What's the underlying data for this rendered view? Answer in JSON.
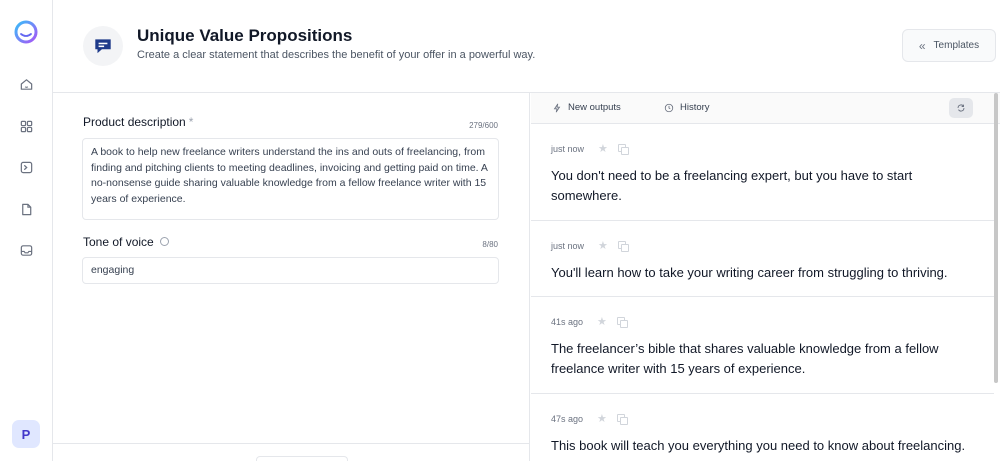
{
  "app": {
    "avatar_letter": "P",
    "accent": "#6366f1"
  },
  "sidebar": {
    "icons": [
      "home-icon",
      "grid-icon",
      "terminal-icon",
      "document-icon",
      "inbox-icon"
    ]
  },
  "header": {
    "title": "Unique Value Propositions",
    "subtitle": "Create a clear statement that describes the benefit of your offer in a powerful way.",
    "templates_label": "Templates",
    "icon": "chat-message-icon"
  },
  "form": {
    "product_description": {
      "label": "Product description",
      "required_mark": "*",
      "counter": "279/600",
      "value": "A book to help new freelance writers understand the ins and outs of freelancing, from finding and pitching clients to meeting deadlines, invoicing and getting paid on time. A no-nonsense guide sharing valuable knowledge from a fellow freelance writer with 15 years of experience."
    },
    "tone_of_voice": {
      "label": "Tone of voice",
      "counter": "8/80",
      "value": "engaging"
    }
  },
  "outputs": {
    "tabs": [
      {
        "label": "New outputs",
        "icon": "lightning-icon"
      },
      {
        "label": "History",
        "icon": "clock-icon"
      }
    ],
    "results": [
      {
        "time": "just now",
        "text": "You don't need to be a freelancing expert, but you have to start somewhere."
      },
      {
        "time": "just now",
        "text": "You'll learn how to take your writing career from struggling to thriving."
      },
      {
        "time": "41s ago",
        "text": "The freelancer’s bible that shares valuable knowledge from a fellow freelance writer with 15 years of experience."
      },
      {
        "time": "47s ago",
        "text": "This book will teach you everything you need to know about freelancing."
      }
    ]
  }
}
